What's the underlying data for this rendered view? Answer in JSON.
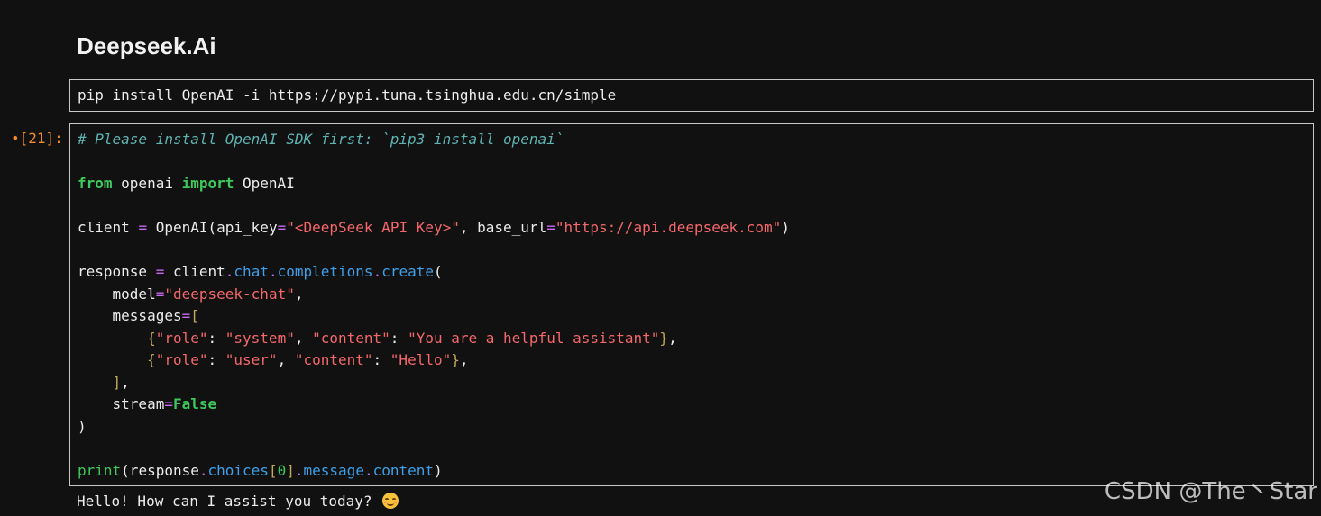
{
  "heading": "Deepseek.Ai",
  "raw_cell": {
    "text": "pip install OpenAI -i https://pypi.tuna.tsinghua.edu.cn/simple"
  },
  "code_cell": {
    "prompt": "•[21]:",
    "lines": [
      [
        {
          "t": "comment",
          "v": "# Please install OpenAI SDK first: `pip3 install openai`"
        }
      ],
      [],
      [
        {
          "t": "kw",
          "v": "from"
        },
        {
          "t": "plain",
          "v": " openai "
        },
        {
          "t": "kw",
          "v": "import"
        },
        {
          "t": "plain",
          "v": " OpenAI"
        }
      ],
      [],
      [
        {
          "t": "plain",
          "v": "client "
        },
        {
          "t": "op",
          "v": "="
        },
        {
          "t": "plain",
          "v": " OpenAI(api_key"
        },
        {
          "t": "op",
          "v": "="
        },
        {
          "t": "str",
          "v": "\"<DeepSeek API Key>\""
        },
        {
          "t": "plain",
          "v": ", base_url"
        },
        {
          "t": "op",
          "v": "="
        },
        {
          "t": "str",
          "v": "\"https://api.deepseek.com\""
        },
        {
          "t": "plain",
          "v": ")"
        }
      ],
      [],
      [
        {
          "t": "plain",
          "v": "response "
        },
        {
          "t": "op",
          "v": "="
        },
        {
          "t": "plain",
          "v": " client"
        },
        {
          "t": "op",
          "v": "."
        },
        {
          "t": "attr",
          "v": "chat"
        },
        {
          "t": "op",
          "v": "."
        },
        {
          "t": "attr",
          "v": "completions"
        },
        {
          "t": "op",
          "v": "."
        },
        {
          "t": "attr",
          "v": "create"
        },
        {
          "t": "plain",
          "v": "("
        }
      ],
      [
        {
          "t": "plain",
          "v": "    model"
        },
        {
          "t": "op",
          "v": "="
        },
        {
          "t": "str",
          "v": "\"deepseek-chat\""
        },
        {
          "t": "plain",
          "v": ","
        }
      ],
      [
        {
          "t": "plain",
          "v": "    messages"
        },
        {
          "t": "op",
          "v": "="
        },
        {
          "t": "punct",
          "v": "["
        }
      ],
      [
        {
          "t": "plain",
          "v": "        "
        },
        {
          "t": "punct",
          "v": "{"
        },
        {
          "t": "str",
          "v": "\"role\""
        },
        {
          "t": "plain",
          "v": ": "
        },
        {
          "t": "str",
          "v": "\"system\""
        },
        {
          "t": "plain",
          "v": ", "
        },
        {
          "t": "str",
          "v": "\"content\""
        },
        {
          "t": "plain",
          "v": ": "
        },
        {
          "t": "str",
          "v": "\"You are a helpful assistant\""
        },
        {
          "t": "punct",
          "v": "}"
        },
        {
          "t": "plain",
          "v": ","
        }
      ],
      [
        {
          "t": "plain",
          "v": "        "
        },
        {
          "t": "punct",
          "v": "{"
        },
        {
          "t": "str",
          "v": "\"role\""
        },
        {
          "t": "plain",
          "v": ": "
        },
        {
          "t": "str",
          "v": "\"user\""
        },
        {
          "t": "plain",
          "v": ", "
        },
        {
          "t": "str",
          "v": "\"content\""
        },
        {
          "t": "plain",
          "v": ": "
        },
        {
          "t": "str",
          "v": "\"Hello\""
        },
        {
          "t": "punct",
          "v": "}"
        },
        {
          "t": "plain",
          "v": ","
        }
      ],
      [
        {
          "t": "plain",
          "v": "    "
        },
        {
          "t": "punct",
          "v": "]"
        },
        {
          "t": "plain",
          "v": ","
        }
      ],
      [
        {
          "t": "plain",
          "v": "    stream"
        },
        {
          "t": "op",
          "v": "="
        },
        {
          "t": "kwconst",
          "v": "False"
        }
      ],
      [
        {
          "t": "plain",
          "v": ")"
        }
      ],
      [],
      [
        {
          "t": "builtin",
          "v": "print"
        },
        {
          "t": "plain",
          "v": "(response"
        },
        {
          "t": "op",
          "v": "."
        },
        {
          "t": "attr",
          "v": "choices"
        },
        {
          "t": "punct",
          "v": "["
        },
        {
          "t": "num",
          "v": "0"
        },
        {
          "t": "punct",
          "v": "]"
        },
        {
          "t": "op",
          "v": "."
        },
        {
          "t": "attr",
          "v": "message"
        },
        {
          "t": "op",
          "v": "."
        },
        {
          "t": "attr",
          "v": "content"
        },
        {
          "t": "plain",
          "v": ")"
        }
      ]
    ]
  },
  "output": {
    "text": "Hello! How can I assist you today? ",
    "emoji_icon": "smiling-face-emoji-icon"
  },
  "watermark": "CSDN @The丶Star",
  "colors": {
    "background": "#111111",
    "prompt": "#f08a28",
    "keyword": "#3ec95a",
    "string": "#f4686b",
    "operator": "#c76bf0",
    "attribute": "#3f9fe8",
    "comment": "#5fb3b3"
  }
}
